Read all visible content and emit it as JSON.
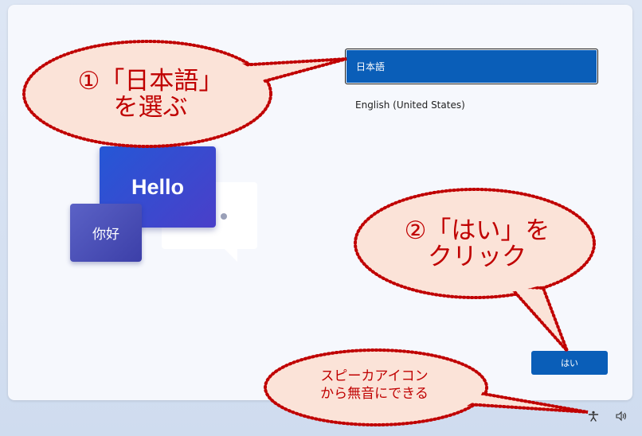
{
  "languages": {
    "items": [
      {
        "label": "日本語",
        "selected": true
      },
      {
        "label": "English (United States)",
        "selected": false
      }
    ]
  },
  "yes_button": {
    "label": "はい"
  },
  "illustration": {
    "hello": "Hello",
    "nihao": "你好"
  },
  "annotations": {
    "step1_line1": "①「日本語」",
    "step1_line2": "を選ぶ",
    "step2_line1": "②「はい」を",
    "step2_line2": "クリック",
    "note_line1": "スピーカアイコン",
    "note_line2": "から無音にできる"
  },
  "tray": {
    "icons": [
      "accessibility-icon",
      "speaker-icon"
    ]
  },
  "colors": {
    "accent": "#0a5eb8",
    "callout_fill": "#fbe3d8",
    "callout_border": "#c00000",
    "callout_text": "#c00000"
  }
}
